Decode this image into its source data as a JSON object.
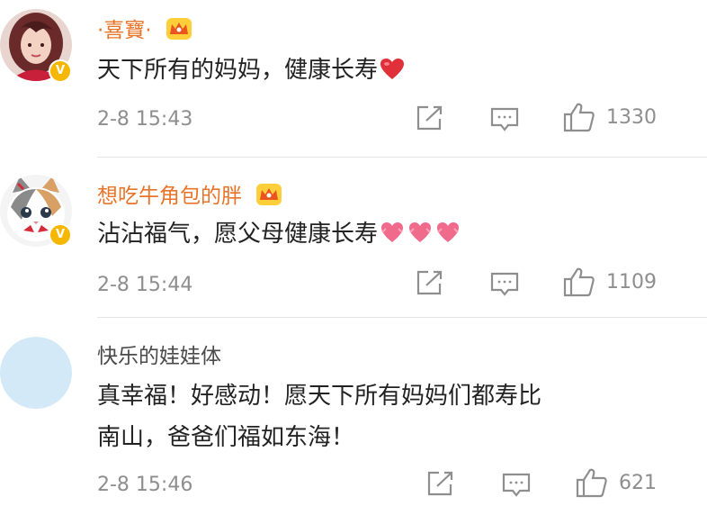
{
  "comments": [
    {
      "username": "·喜寶·",
      "text": "天下所有的妈妈，健康长寿",
      "emoji_icon": "red-heart-icon",
      "timestamp": "2-8 15:43",
      "likes": "1330",
      "verified": true,
      "crown": true
    },
    {
      "username": "想吃牛角包的胖",
      "text": "沾沾福气，愿父母健康长寿",
      "emoji_icon": "pink-heart-emoji",
      "timestamp": "2-8 15:44",
      "likes": "1109",
      "verified": true,
      "crown": true
    },
    {
      "username": "快乐的娃娃体",
      "text_line1": "真幸福！好感动！愿天下所有妈妈们都寿比",
      "text_line2": "南山，爸爸们福如东海！",
      "timestamp": "2-8 15:46",
      "likes": "621",
      "verified": false,
      "crown": false
    }
  ],
  "colors": {
    "username_highlight": "#e8742a",
    "badge": "#f5b700",
    "meta_gray": "#8e8e8e",
    "placeholder_avatar": "#d4e9f8"
  }
}
